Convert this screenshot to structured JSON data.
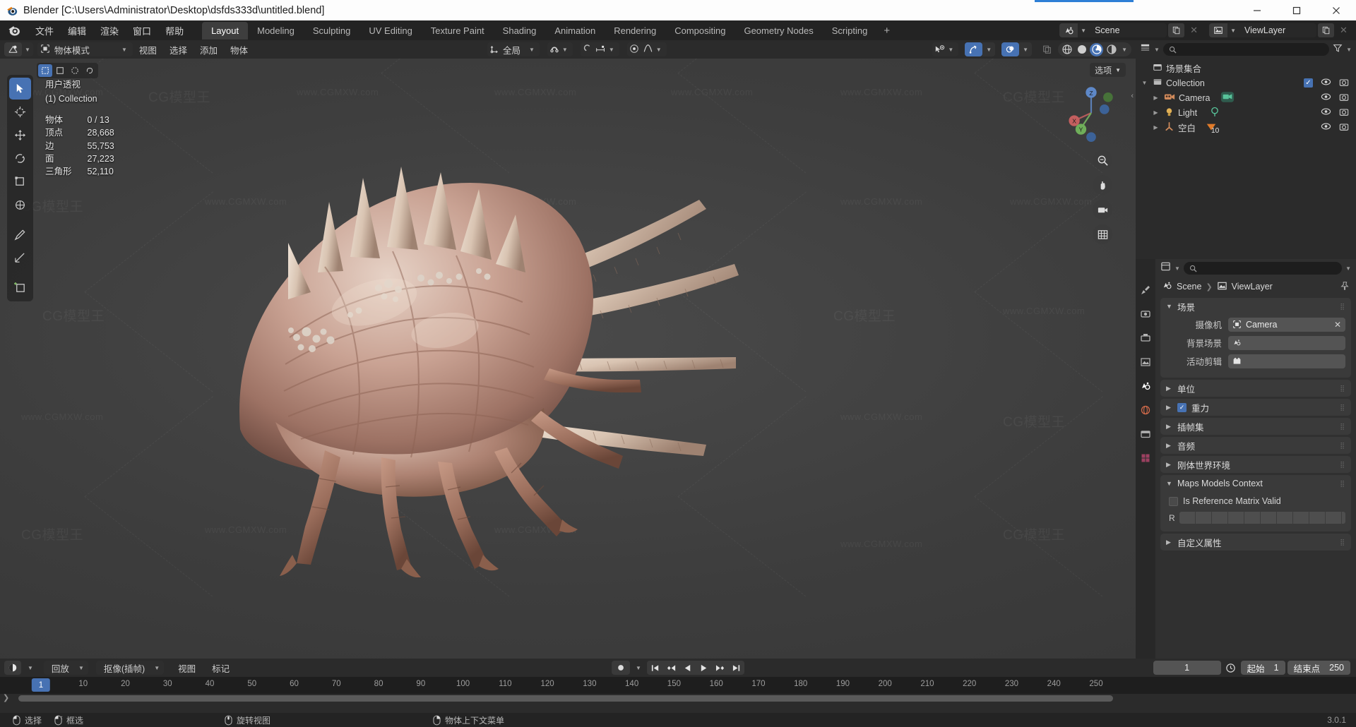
{
  "window": {
    "title": "Blender [C:\\Users\\Administrator\\Desktop\\dsfds333d\\untitled.blend]",
    "minimize": "–",
    "maximize": "□",
    "close": "✕"
  },
  "topbar": {
    "menus": [
      "文件",
      "编辑",
      "渲染",
      "窗口",
      "帮助"
    ],
    "workspaces": [
      {
        "label": "Layout",
        "active": true
      },
      {
        "label": "Modeling",
        "active": false
      },
      {
        "label": "Sculpting",
        "active": false
      },
      {
        "label": "UV Editing",
        "active": false
      },
      {
        "label": "Texture Paint",
        "active": false
      },
      {
        "label": "Shading",
        "active": false
      },
      {
        "label": "Animation",
        "active": false
      },
      {
        "label": "Rendering",
        "active": false
      },
      {
        "label": "Compositing",
        "active": false
      },
      {
        "label": "Geometry Nodes",
        "active": false
      },
      {
        "label": "Scripting",
        "active": false
      }
    ],
    "add_workspace": "+",
    "scene_name": "Scene",
    "viewlayer_name": "ViewLayer"
  },
  "viewport_header": {
    "mode": "物体模式",
    "menus": [
      "视图",
      "选择",
      "添加",
      "物体"
    ],
    "transform_orientation": "全局"
  },
  "viewport": {
    "options_label": "选项",
    "stats": {
      "view_name": "用户透视",
      "collection": "(1) Collection",
      "rows": [
        {
          "key": "物体",
          "value": "0 / 13"
        },
        {
          "key": "顶点",
          "value": "28,668"
        },
        {
          "key": "边",
          "value": "55,753"
        },
        {
          "key": "面",
          "value": "27,223"
        },
        {
          "key": "三角形",
          "value": "52,110"
        }
      ]
    },
    "gizmo_axes": {
      "x": "X",
      "y": "Y",
      "z": "Z"
    },
    "watermark_text": "www.CGMXW.com",
    "watermark_brand": "CG模型王"
  },
  "outliner": {
    "search_placeholder": "",
    "scene_collection": "场景集合",
    "items": [
      {
        "label": "Collection",
        "indent": 0,
        "checkbox": true,
        "icon": "collection-icon",
        "badge": ""
      },
      {
        "label": "Camera",
        "indent": 1,
        "checkbox": false,
        "icon": "camera-icon",
        "badge": ""
      },
      {
        "label": "Light",
        "indent": 1,
        "checkbox": false,
        "icon": "light-icon",
        "badge": ""
      },
      {
        "label": "空白",
        "indent": 1,
        "checkbox": false,
        "icon": "empty-icon",
        "badge": "10"
      }
    ]
  },
  "properties": {
    "search_placeholder": "",
    "breadcrumb": [
      "Scene",
      "ViewLayer"
    ],
    "scene_panel": {
      "title": "场景",
      "fields": [
        {
          "label": "摄像机",
          "value": "Camera",
          "icon": "camera-data-icon",
          "has_x": true
        },
        {
          "label": "背景场景",
          "value": "",
          "icon": "scene-icon",
          "has_x": false
        },
        {
          "label": "活动剪辑",
          "value": "",
          "icon": "clip-icon",
          "has_x": false
        }
      ]
    },
    "collapsed_panels": [
      {
        "title": "单位",
        "checkbox": null
      },
      {
        "title": "重力",
        "checkbox": true
      },
      {
        "title": "插帧集",
        "checkbox": null
      },
      {
        "title": "音频",
        "checkbox": null
      },
      {
        "title": "刚体世界环境",
        "checkbox": null
      }
    ],
    "maps_panel": {
      "title": "Maps Models Context",
      "checkbox_label": "Is Reference Matrix Valid",
      "checkbox_value": false,
      "matrix_label": "R"
    },
    "custom_props": {
      "title": "自定义属性"
    }
  },
  "timeline": {
    "menus": [
      "回放",
      "抠像(插帧)",
      "视图",
      "标记"
    ],
    "current_frame": "1",
    "start_label": "起始",
    "start_value": "1",
    "end_label": "结束点",
    "end_value": "250",
    "ticks": [
      "1",
      "10",
      "20",
      "30",
      "40",
      "50",
      "60",
      "70",
      "80",
      "90",
      "100",
      "110",
      "120",
      "130",
      "140",
      "150",
      "160",
      "170",
      "180",
      "190",
      "200",
      "210",
      "220",
      "230",
      "240",
      "250"
    ],
    "playhead_frame": "1"
  },
  "statusbar": {
    "items": [
      {
        "icon": "mouse-left-icon",
        "label": "选择"
      },
      {
        "icon": "mouse-drag-icon",
        "label": "框选"
      },
      {
        "icon": "mouse-middle-icon",
        "label": "旋转视图"
      },
      {
        "icon": "mouse-right-icon",
        "label": "物体上下文菜单"
      }
    ],
    "version": "3.0.1"
  },
  "colors": {
    "accent": "#4772b3",
    "panel": "#303030",
    "header": "#2b2b2b",
    "viewport": "#3d3d3d",
    "titlebar": "#fdfdfd"
  }
}
